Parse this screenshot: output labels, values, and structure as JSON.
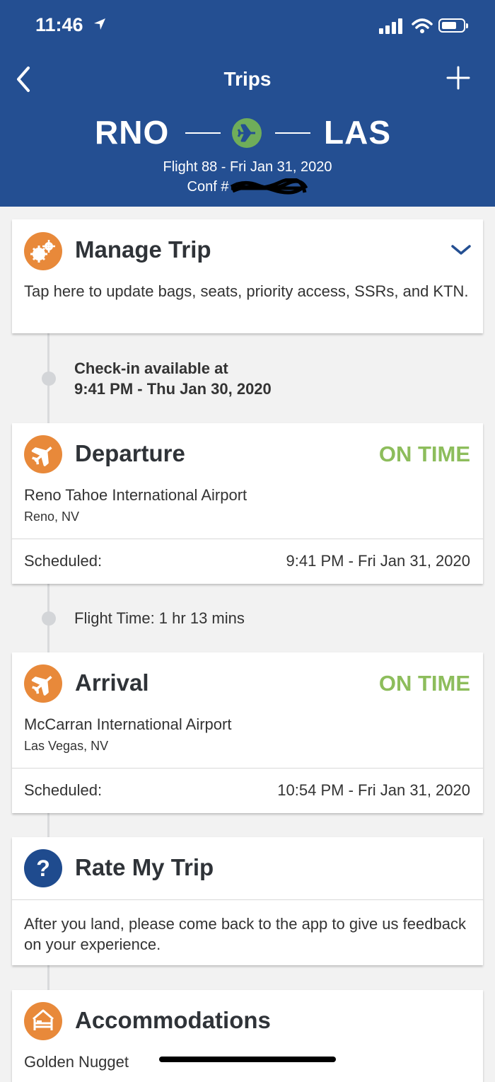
{
  "status_bar": {
    "time": "11:46"
  },
  "nav": {
    "title": "Trips"
  },
  "route": {
    "from": "RNO",
    "to": "LAS",
    "flight_line": "Flight 88 - Fri Jan 31, 2020",
    "conf_label": "Conf #"
  },
  "manage": {
    "title": "Manage Trip",
    "description": "Tap here to update bags, seats, priority access, SSRs, and KTN."
  },
  "checkin": {
    "line1": "Check-in available at",
    "line2": "9:41 PM - Thu Jan 30, 2020"
  },
  "departure": {
    "title": "Departure",
    "status": "ON TIME",
    "airport": "Reno Tahoe International Airport",
    "city": "Reno, NV",
    "scheduled_label": "Scheduled:",
    "scheduled_value": "9:41 PM - Fri Jan 31, 2020"
  },
  "flight_time": "Flight Time: 1 hr 13 mins",
  "arrival": {
    "title": "Arrival",
    "status": "ON TIME",
    "airport": "McCarran International Airport",
    "city": "Las Vegas, NV",
    "scheduled_label": "Scheduled:",
    "scheduled_value": "10:54 PM - Fri Jan 31, 2020"
  },
  "rate": {
    "title": "Rate My Trip",
    "description": "After you land, please come back to the app to give us feedback on your experience."
  },
  "accommodations": {
    "title": "Accommodations",
    "hotel": "Golden Nugget"
  },
  "colors": {
    "header_bg": "#244f92",
    "on_time": "#8dbd5c",
    "icon_orange": "#e8893a",
    "icon_navy": "#1f4b8e",
    "plane_green": "#6fad5a"
  }
}
